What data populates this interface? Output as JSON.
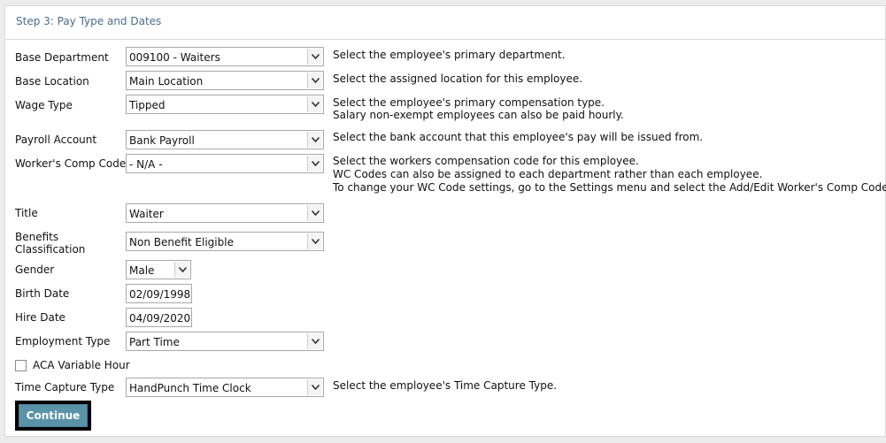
{
  "step_title": "Step 3: Pay Type and Dates",
  "fields": {
    "base_department": {
      "label": "Base Department",
      "value": "009100 - Waiters",
      "help": [
        "Select the employee's primary department."
      ]
    },
    "base_location": {
      "label": "Base Location",
      "value": "Main Location",
      "help": [
        "Select the assigned location for this employee."
      ]
    },
    "wage_type": {
      "label": "Wage Type",
      "value": "Tipped",
      "help": [
        "Select the employee's primary compensation type.",
        "Salary non-exempt employees can also be paid hourly."
      ]
    },
    "payroll_account": {
      "label": "Payroll Account",
      "value": "Bank Payroll",
      "help": [
        "Select the bank account that this employee's pay will be issued from."
      ]
    },
    "workers_comp": {
      "label": "Worker's Comp Code",
      "value": "- N/A -",
      "help": [
        "Select the workers compensation code for this employee.",
        "WC Codes can also be assigned to each department rather than each employee.",
        "To change your WC Code settings, go to the Settings menu and select the Add/Edit Worker's Comp Codes link."
      ]
    },
    "title": {
      "label": "Title",
      "value": "Waiter"
    },
    "benefits": {
      "label_line1": "Benefits",
      "label_line2": "Classification",
      "value": "Non Benefit Eligible"
    },
    "gender": {
      "label": "Gender",
      "value": "Male"
    },
    "birth_date": {
      "label": "Birth Date",
      "value": "02/09/1998"
    },
    "hire_date": {
      "label": "Hire Date",
      "value": "04/09/2020"
    },
    "employment_type": {
      "label": "Employment Type",
      "value": "Part Time"
    },
    "aca_variable_hour": {
      "label": "ACA Variable Hour",
      "checked": false
    },
    "time_capture": {
      "label": "Time Capture Type",
      "value": "HandPunch Time Clock",
      "help": [
        "Select the employee's Time Capture Type."
      ]
    }
  },
  "continue_label": "Continue",
  "icons": {
    "dropdown": "chevron-down-icon"
  },
  "colors": {
    "title": "#4a6d8c",
    "button": "#5a93a9"
  }
}
